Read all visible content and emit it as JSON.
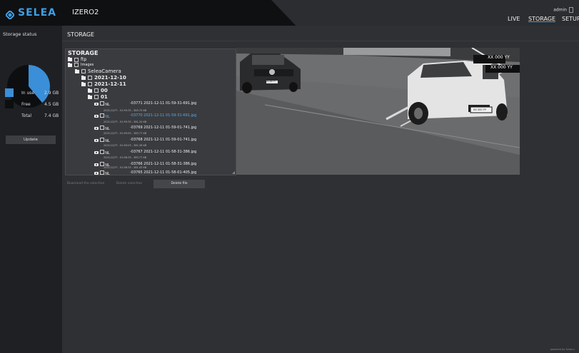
{
  "brand": {
    "logo_text": "SELEA",
    "accent_color": "#3ea0e6"
  },
  "header": {
    "device_name": "IZERO2",
    "nav": {
      "live": "LIVE",
      "storage": "STORAGE",
      "setup": "SETUP"
    },
    "user": "admin"
  },
  "sidebar": {
    "title": "Storage status",
    "legend": [
      {
        "label": "In use",
        "value": "2.9 GB",
        "color": "#3a8fd8"
      },
      {
        "label": "Free",
        "value": "4.5 GB",
        "color": "#0d0e10"
      },
      {
        "label": "Total",
        "value": "7.4 GB"
      }
    ],
    "usage_fraction": 0.39,
    "update_label": "Update"
  },
  "page": {
    "title": "STORAGE"
  },
  "tree": {
    "root": "STORAGE",
    "folders": {
      "ftp": "ftp",
      "images": "Images",
      "camera": "SeleaCamera",
      "date1": "2021-12-10",
      "date2": "2021-12-11",
      "h00": "00",
      "h01": "01"
    },
    "files": [
      {
        "prefix": "NL",
        "name": "-03771 2021-12-11 01-59-31-691.jpg",
        "meta": ""
      },
      {
        "prefix": "NL",
        "name": "-03770 2021-12-11 01-59-31-691.jpg",
        "meta": "2021/12/?? - 01:59:33 - 383.75 KB"
      },
      {
        "prefix": "NL",
        "name": "-03769 2021-12-11 01-59-01-741.jpg",
        "meta": "2021/12/?? - 01:59:33 - 381.20 KB"
      },
      {
        "prefix": "NL",
        "name": "-03768 2021-12-11 01-59-01-741.jpg",
        "meta": "2021/12/?? - 01:59:03 - 383.77 KB"
      },
      {
        "prefix": "NL",
        "name": "-03767 2021-12-11 01-58-31-386.jpg",
        "meta": "2021/12/?? - 01:59:03 - 381.36 KB"
      },
      {
        "prefix": "NL",
        "name": "-03766 2021-12-11 01-58-31-386.jpg",
        "meta": "2021/12/?? - 01:58:33 - 383.77 KB"
      },
      {
        "prefix": "NL",
        "name": "-03765 2021-12-11 01-58-01-405.jpg",
        "meta": "2021/12/?? - 01:58:33 - 381.43 KB"
      }
    ]
  },
  "photo": {
    "plate_top": "XX 000 YY",
    "plate_mid": "XX 000 YY",
    "plate_car": "XX 000 YY",
    "plate_left": "XX 000 YY"
  },
  "actions": {
    "download": "Download the selection",
    "delete_selection": "Delete selection",
    "delete_file": "Delete file"
  },
  "footer": {
    "text": "powered by Selea s"
  }
}
